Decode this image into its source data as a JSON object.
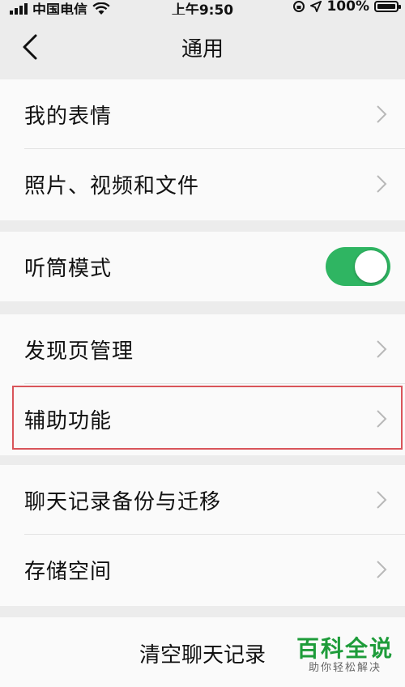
{
  "status_bar": {
    "carrier": "中国电信",
    "time": "上午9:50",
    "battery": "100%",
    "icons": [
      "signal-icon",
      "wifi-icon",
      "rotation-lock-icon",
      "location-icon",
      "battery-icon"
    ]
  },
  "nav": {
    "title": "通用",
    "back_icon": "chevron-left-icon"
  },
  "groups": [
    {
      "items": [
        {
          "label": "我的表情"
        },
        {
          "label": "照片、视频和文件"
        }
      ]
    },
    {
      "items": [
        {
          "label": "听筒模式",
          "toggle_on": true
        }
      ]
    },
    {
      "items": [
        {
          "label": "发现页管理"
        },
        {
          "label": "辅助功能"
        }
      ]
    },
    {
      "items": [
        {
          "label": "聊天记录备份与迁移"
        },
        {
          "label": "存储空间"
        }
      ]
    }
  ],
  "clear_chat": {
    "label": "清空聊天记录"
  },
  "watermark": {
    "title": "百科全说",
    "subtitle": "助你轻松解决"
  },
  "colors": {
    "toggle_on": "#2fb562",
    "highlight_border": "#d9545a",
    "watermark": "#1e9c3a",
    "background": "#ececec",
    "cell": "#fafafa"
  }
}
